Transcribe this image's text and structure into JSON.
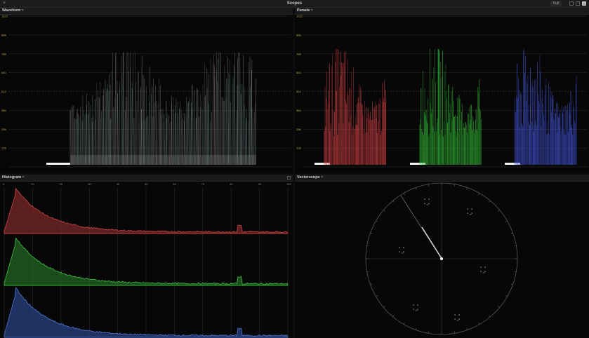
{
  "window": {
    "title": "Scopes",
    "view_label": "Full"
  },
  "panels": {
    "waveform": {
      "title": "Waveform"
    },
    "parade": {
      "title": "Parade"
    },
    "histogram": {
      "title": "Histogram"
    },
    "vectorscope": {
      "title": "Vectorscope"
    }
  },
  "waveform_scale": [
    "1023",
    "896",
    "768",
    "640",
    "512",
    "384",
    "256",
    "128"
  ],
  "histogram_scale": [
    "0",
    "10",
    "20",
    "30",
    "40",
    "50",
    "60",
    "70",
    "80",
    "90",
    "100"
  ],
  "colors": {
    "red": "#e8474a",
    "green": "#38d13c",
    "blue": "#4a5ef0",
    "scale_text": "#c8b640"
  },
  "icons": [
    "close-icon",
    "layout-single-icon",
    "layout-dual-icon",
    "layout-quad-icon",
    "panel-options-icon"
  ]
}
